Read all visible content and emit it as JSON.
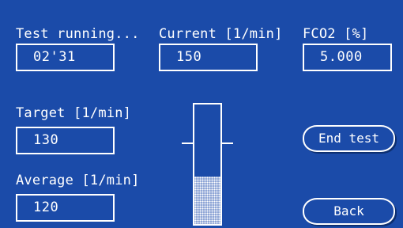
{
  "status": {
    "label": "Test running...",
    "timer_value": "02'31"
  },
  "current": {
    "label": "Current [1/min]",
    "value": "150"
  },
  "fco2": {
    "label": "FCO2 [%]",
    "value": "5.000"
  },
  "target": {
    "label": "Target [1/min]",
    "value": "130"
  },
  "average": {
    "label": "Average [1/min]",
    "value": "120"
  },
  "gauge": {
    "level_fraction": 0.4,
    "target_marker_fraction": 0.67
  },
  "buttons": {
    "end_test": "End test",
    "back": "Back"
  },
  "colors": {
    "background": "#1b4ba9",
    "foreground": "#ffffff"
  }
}
